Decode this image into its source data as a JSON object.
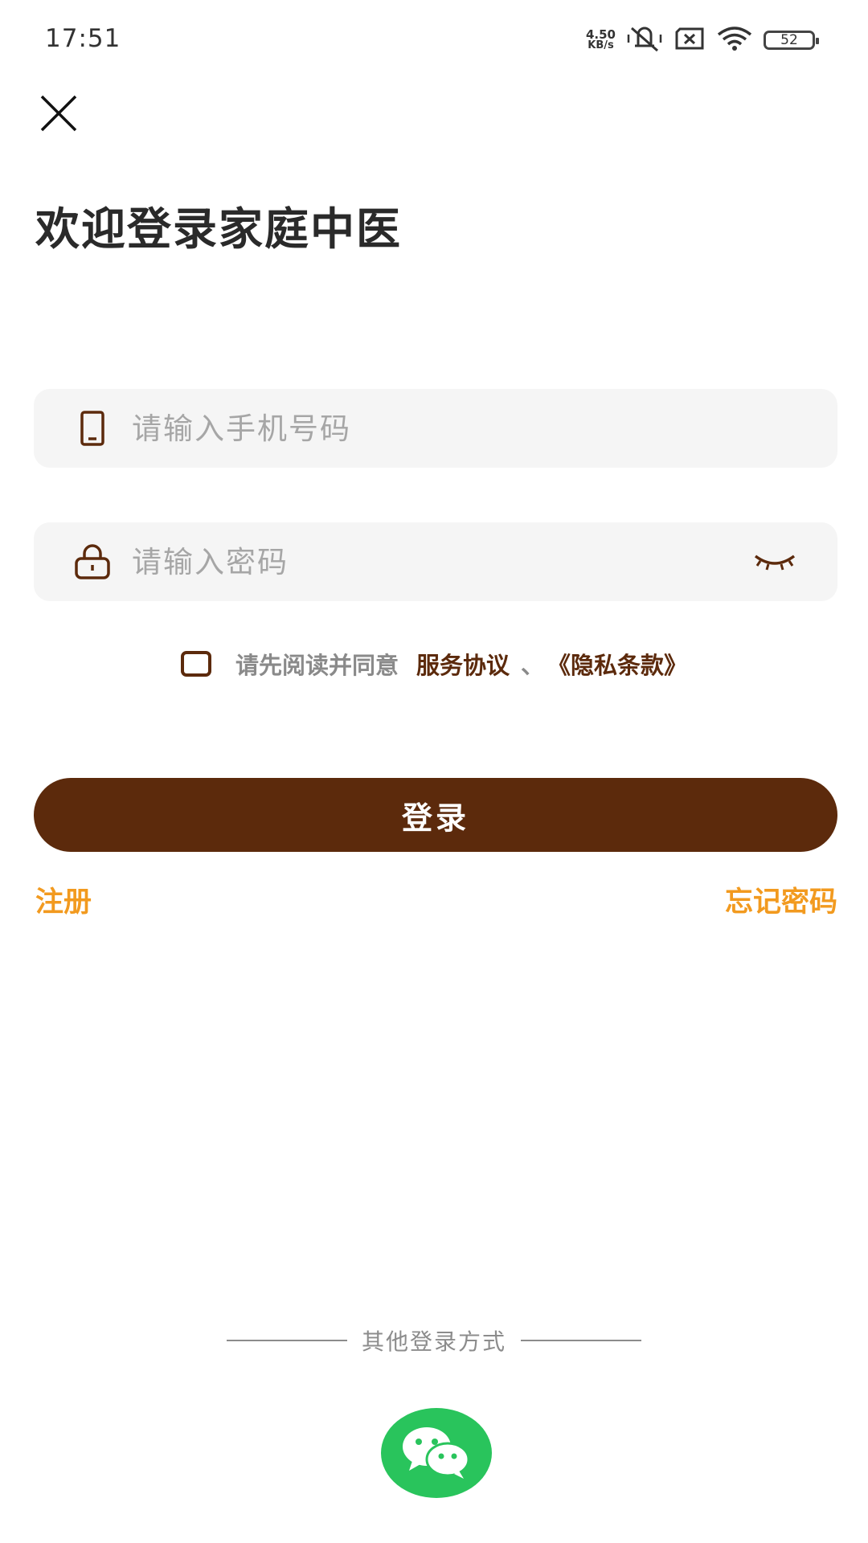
{
  "status_bar": {
    "time": "17:51",
    "net_speed_value": "4.50",
    "net_speed_unit": "KB/s",
    "battery": "52",
    "icons": [
      "net-speed-icon",
      "mute-vibrate-icon",
      "no-sim-icon",
      "wifi-icon",
      "battery-icon"
    ]
  },
  "header": {
    "close_icon": "close-icon",
    "title": "欢迎登录家庭中医"
  },
  "form": {
    "phone_placeholder": "请输入手机号码",
    "phone_icon": "phone-icon",
    "password_placeholder": "请输入密码",
    "password_icon": "lock-icon",
    "toggle_icon": "eye-closed-icon"
  },
  "agreement": {
    "prefix": "请先阅读并同意",
    "service_link": "服务协议",
    "separator": "、",
    "privacy_link": "《隐私条款》",
    "checked": false
  },
  "actions": {
    "login_label": "登录",
    "register_label": "注册",
    "forgot_label": "忘记密码"
  },
  "other_login": {
    "label": "其他登录方式",
    "wechat_icon": "wechat-icon"
  },
  "colors": {
    "primary": "#5c2a0c",
    "accent": "#f29a1f",
    "wechat": "#29c45c",
    "field_bg": "#f5f5f5"
  }
}
